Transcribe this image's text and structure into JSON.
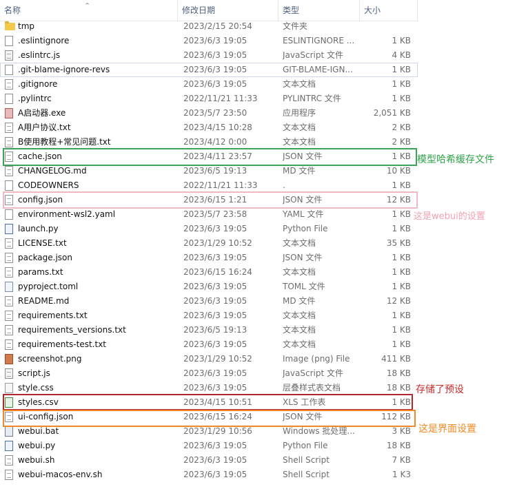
{
  "columns": {
    "name": "名称",
    "date": "修改日期",
    "type": "类型",
    "size": "大小"
  },
  "files": [
    {
      "name": "tmp",
      "date": "2023/2/15 20:54",
      "type": "文件夹",
      "size": "",
      "icon": "folder-icon"
    },
    {
      "name": ".eslintignore",
      "date": "2023/6/3 19:05",
      "type": "ESLINTIGNORE ...",
      "size": "1 KB",
      "icon": "file-icon"
    },
    {
      "name": ".eslintrc.js",
      "date": "2023/6/3 19:05",
      "type": "JavaScript 文件",
      "size": "4 KB",
      "icon": "javascript-file-icon"
    },
    {
      "name": ".git-blame-ignore-revs",
      "date": "2023/6/3 19:05",
      "type": "GIT-BLAME-IGN...",
      "size": "1 KB",
      "icon": "file-icon"
    },
    {
      "name": ".gitignore",
      "date": "2023/6/3 19:05",
      "type": "文本文档",
      "size": "1 KB",
      "icon": "text-file-icon"
    },
    {
      "name": ".pylintrc",
      "date": "2022/11/21 11:33",
      "type": "PYLINTRC 文件",
      "size": "1 KB",
      "icon": "file-icon"
    },
    {
      "name": "A启动器.exe",
      "date": "2023/5/7 23:50",
      "type": "应用程序",
      "size": "2,051 KB",
      "icon": "exe-icon"
    },
    {
      "name": "A用户协议.txt",
      "date": "2023/4/15 10:28",
      "type": "文本文档",
      "size": "2 KB",
      "icon": "text-file-icon"
    },
    {
      "name": "B使用教程+常见问题.txt",
      "date": "2023/4/12 0:00",
      "type": "文本文档",
      "size": "2 KB",
      "icon": "text-file-icon"
    },
    {
      "name": "cache.json",
      "date": "2023/4/11 23:57",
      "type": "JSON 文件",
      "size": "1 KB",
      "icon": "json-file-icon"
    },
    {
      "name": "CHANGELOG.md",
      "date": "2023/6/5 19:13",
      "type": "MD 文件",
      "size": "10 KB",
      "icon": "markdown-file-icon"
    },
    {
      "name": "CODEOWNERS",
      "date": "2022/11/21 11:33",
      "type": ".",
      "size": "1 KB",
      "icon": "file-icon"
    },
    {
      "name": "config.json",
      "date": "2023/6/15 1:21",
      "type": "JSON 文件",
      "size": "12 KB",
      "icon": "json-file-icon"
    },
    {
      "name": "environment-wsl2.yaml",
      "date": "2023/5/7 23:58",
      "type": "YAML 文件",
      "size": "1 KB",
      "icon": "file-icon"
    },
    {
      "name": "launch.py",
      "date": "2023/6/3 19:05",
      "type": "Python File",
      "size": "1 KB",
      "icon": "python-file-icon"
    },
    {
      "name": "LICENSE.txt",
      "date": "2023/1/29 10:52",
      "type": "文本文档",
      "size": "35 KB",
      "icon": "text-file-icon"
    },
    {
      "name": "package.json",
      "date": "2023/6/3 19:05",
      "type": "JSON 文件",
      "size": "1 KB",
      "icon": "json-file-icon"
    },
    {
      "name": "params.txt",
      "date": "2023/6/15 16:24",
      "type": "文本文档",
      "size": "1 KB",
      "icon": "text-file-icon"
    },
    {
      "name": "pyproject.toml",
      "date": "2023/6/3 19:05",
      "type": "TOML 文件",
      "size": "1 KB",
      "icon": "toml-file-icon"
    },
    {
      "name": "README.md",
      "date": "2023/6/3 19:05",
      "type": "MD 文件",
      "size": "12 KB",
      "icon": "markdown-file-icon"
    },
    {
      "name": "requirements.txt",
      "date": "2023/6/3 19:05",
      "type": "文本文档",
      "size": "1 KB",
      "icon": "text-file-icon"
    },
    {
      "name": "requirements_versions.txt",
      "date": "2023/6/5 19:13",
      "type": "文本文档",
      "size": "1 KB",
      "icon": "text-file-icon"
    },
    {
      "name": "requirements-test.txt",
      "date": "2023/6/3 19:05",
      "type": "文本文档",
      "size": "1 KB",
      "icon": "text-file-icon"
    },
    {
      "name": "screenshot.png",
      "date": "2023/1/29 10:52",
      "type": "Image (png) File",
      "size": "411 KB",
      "icon": "image-file-icon"
    },
    {
      "name": "script.js",
      "date": "2023/6/3 19:05",
      "type": "JavaScript 文件",
      "size": "18 KB",
      "icon": "javascript-file-icon"
    },
    {
      "name": "style.css",
      "date": "2023/6/3 19:05",
      "type": "层叠样式表文档",
      "size": "18 KB",
      "icon": "css-file-icon"
    },
    {
      "name": "styles.csv",
      "date": "2023/4/15 10:51",
      "type": "XLS 工作表",
      "size": "1 KB",
      "icon": "spreadsheet-file-icon"
    },
    {
      "name": "ui-config.json",
      "date": "2023/6/15 16:24",
      "type": "JSON 文件",
      "size": "112 KB",
      "icon": "json-file-icon"
    },
    {
      "name": "webui.bat",
      "date": "2023/1/29 10:56",
      "type": "Windows 批处理...",
      "size": "3 KB",
      "icon": "batch-file-icon"
    },
    {
      "name": "webui.py",
      "date": "2023/6/3 19:05",
      "type": "Python File",
      "size": "18 KB",
      "icon": "python-file-icon"
    },
    {
      "name": "webui.sh",
      "date": "2023/6/3 19:05",
      "type": "Shell Script",
      "size": "7 KB",
      "icon": "shell-file-icon"
    },
    {
      "name": "webui-macos-env.sh",
      "date": "2023/6/3 19:05",
      "type": "Shell Script",
      "size": "1 K3",
      "icon": "shell-file-icon"
    }
  ],
  "annotations": {
    "cache": "模型哈希缓存文件",
    "config": "这是webui的设置",
    "styles": "存储了预设",
    "ui_config": "这是界面设置"
  },
  "colors": {
    "green": "#3aa35a",
    "pink": "#f0b8c2",
    "red": "#b0262e",
    "orange": "#f0882a"
  }
}
